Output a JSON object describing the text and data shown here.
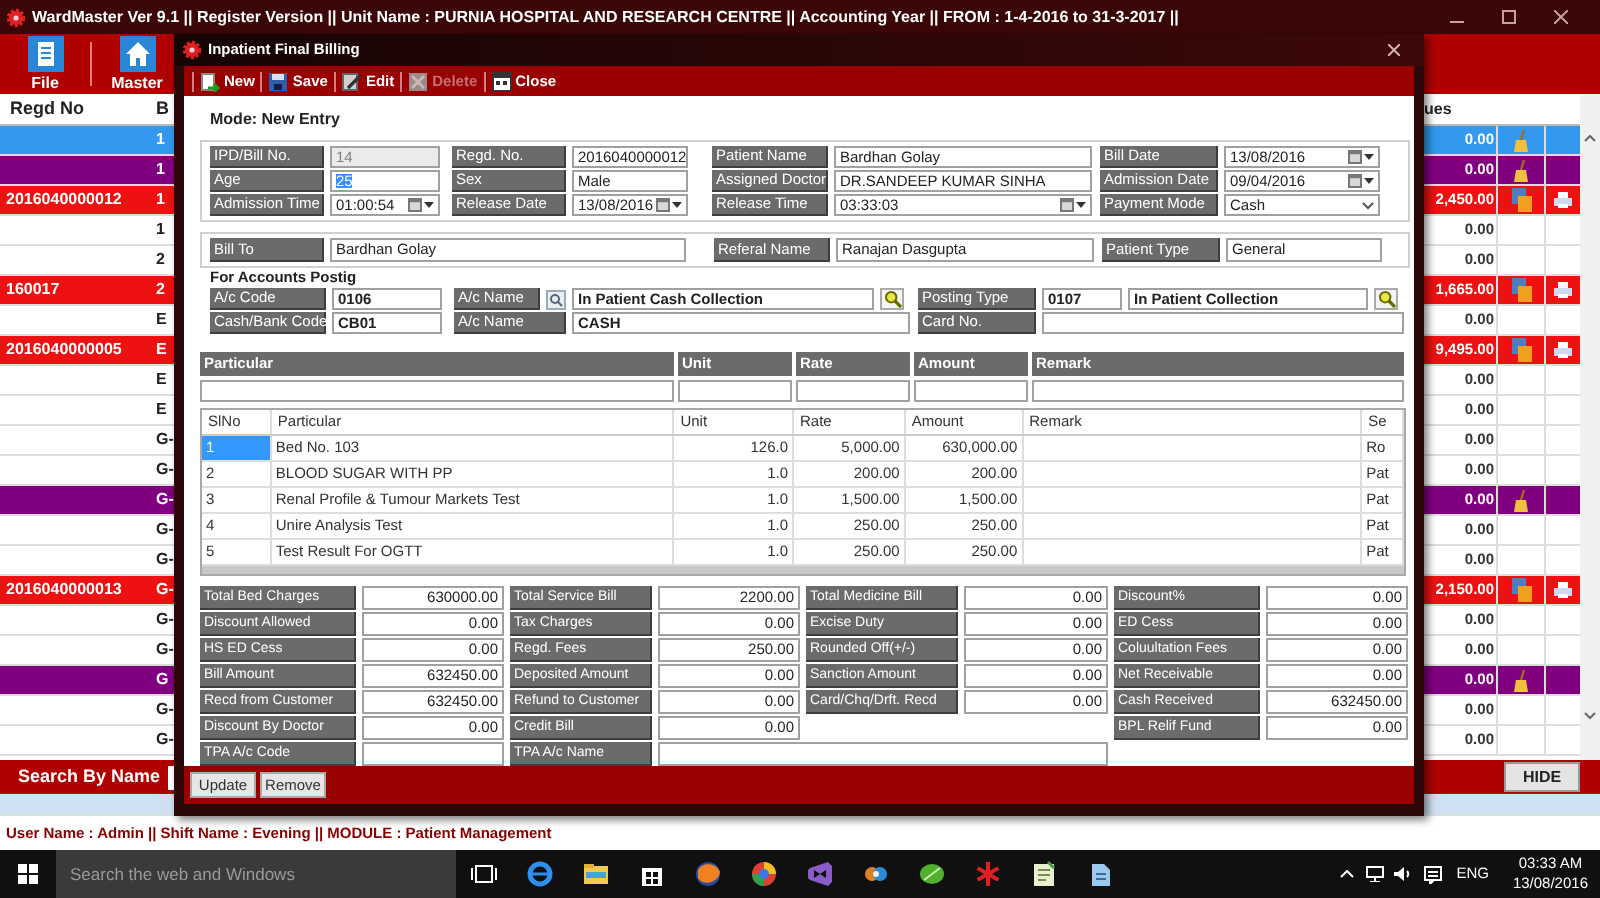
{
  "app_title": "WardMaster Ver 9.1 || Register Version || Unit Name : PURNIA HOSPITAL AND RESEARCH CENTRE || Accounting Year || FROM : 1-4-2016 to 31-3-2017  ||",
  "ribbon": [
    {
      "label": "File",
      "kind": "file"
    },
    {
      "label": "Master",
      "kind": "home"
    }
  ],
  "list": {
    "columns": [
      "Regd No",
      "B",
      "ues"
    ],
    "rows": [
      {
        "column_2": "1",
        "value": "0.00",
        "color": "#3399ee",
        "kind": "cleared"
      },
      {
        "column_2": "1",
        "value": "0.00",
        "color": "#800080",
        "kind": "cleared"
      },
      {
        "regd_no": "2016040000012",
        "column_2": "1",
        "value": "2,450.00",
        "color": "#ee1111",
        "kind": "billed"
      },
      {
        "column_2": "1",
        "value": "0.00",
        "color": "#ffffff",
        "kind": "plain"
      },
      {
        "column_2": "2",
        "value": "0.00",
        "color": "#ffffff",
        "kind": "plain"
      },
      {
        "regd_no": "160017",
        "column_2": "2",
        "value": "1,665.00",
        "color": "#ee1111",
        "kind": "billed"
      },
      {
        "column_2": "E",
        "value": "0.00",
        "color": "#ffffff",
        "kind": "plain"
      },
      {
        "regd_no": "2016040000005",
        "column_2": "E",
        "value": "9,495.00",
        "color": "#ee1111",
        "kind": "billed"
      },
      {
        "column_2": "E",
        "value": "0.00",
        "color": "#ffffff",
        "kind": "plain"
      },
      {
        "column_2": "E",
        "value": "0.00",
        "color": "#ffffff",
        "kind": "plain"
      },
      {
        "column_2": "G-",
        "value": "0.00",
        "color": "#ffffff",
        "kind": "plain"
      },
      {
        "column_2": "G-",
        "value": "0.00",
        "color": "#ffffff",
        "kind": "plain"
      },
      {
        "column_2": "G-",
        "value": "0.00",
        "color": "#800080",
        "kind": "cleared"
      },
      {
        "column_2": "G-",
        "value": "0.00",
        "color": "#ffffff",
        "kind": "plain"
      },
      {
        "column_2": "G-",
        "value": "0.00",
        "color": "#ffffff",
        "kind": "plain"
      },
      {
        "regd_no": "2016040000013",
        "column_2": "G-",
        "value": "2,150.00",
        "color": "#ee1111",
        "kind": "billed"
      },
      {
        "column_2": "G-",
        "value": "0.00",
        "color": "#ffffff",
        "kind": "plain"
      },
      {
        "column_2": "G-",
        "value": "0.00",
        "color": "#ffffff",
        "kind": "plain"
      },
      {
        "column_2": "G",
        "value": "0.00",
        "color": "#800080",
        "kind": "cleared"
      },
      {
        "column_2": "G-",
        "value": "0.00",
        "color": "#ffffff",
        "kind": "plain"
      },
      {
        "column_2": "G-",
        "value": "0.00",
        "color": "#ffffff",
        "kind": "plain"
      }
    ]
  },
  "search_label": "Search By Name",
  "hide_button": "HIDE",
  "status_line": "User Name : Admin || Shift Name : Evening || MODULE : Patient Management",
  "dialog": {
    "title": "Inpatient Final Billing",
    "toolbar": [
      {
        "label": "New",
        "kind": "new",
        "disabled": false
      },
      {
        "label": "Save",
        "kind": "save",
        "disabled": false
      },
      {
        "label": "Edit",
        "kind": "edit",
        "disabled": false
      },
      {
        "label": "Delete",
        "kind": "delete",
        "disabled": true
      },
      {
        "label": "Close",
        "kind": "close",
        "disabled": false
      }
    ],
    "mode": "Mode: New Entry",
    "patient_rows": [
      [
        {
          "label": "IPD/Bill No.",
          "value": "14",
          "kind": "readonly"
        },
        {
          "label": "Regd. No.",
          "value": "2016040000012",
          "kind": "text"
        },
        {
          "label": "Patient Name",
          "value": "Bardhan Golay",
          "kind": "text"
        },
        {
          "label": "Bill Date",
          "value": "13/08/2016",
          "kind": "picker"
        }
      ],
      [
        {
          "label": "Age",
          "value": "25",
          "kind": "highlighted"
        },
        {
          "label": "Sex",
          "value": "Male",
          "kind": "text"
        },
        {
          "label": "Assigned Doctor",
          "value": "DR.SANDEEP KUMAR SINHA",
          "kind": "text"
        },
        {
          "label": "Admission Date",
          "value": "09/04/2016",
          "kind": "picker"
        }
      ],
      [
        {
          "label": "Admission Time",
          "value": "01:00:54",
          "kind": "picker"
        },
        {
          "label": "Release Date",
          "value": "13/08/2016",
          "kind": "picker"
        },
        {
          "label": "Release Time",
          "value": "03:33:03",
          "kind": "picker"
        },
        {
          "label": "Payment Mode",
          "value": "Cash",
          "kind": "select"
        }
      ]
    ],
    "bill_row": [
      {
        "label": "Bill To",
        "value": "Bardhan Golay"
      },
      {
        "label": "Referal Name",
        "value": "Ranajan Dasgupta"
      },
      {
        "label": "Patient Type",
        "value": "General"
      }
    ],
    "accounts_heading": "For Accounts Postig",
    "accounts_rows": [
      [
        {
          "label": "A/c Code",
          "value": "0106"
        },
        {
          "label": "A/c Name",
          "value": "In Patient Cash Collection",
          "label_icon": true,
          "lookup": true
        },
        {
          "label": "Posting Type",
          "value": "0107",
          "value_2": "In Patient Collection",
          "lookup": true
        }
      ],
      [
        {
          "label": "Cash/Bank Code",
          "value": "CB01"
        },
        {
          "label": "A/c Name",
          "value": "CASH"
        },
        {
          "label": "Card No."
        }
      ]
    ],
    "entry_columns": [
      "Particular",
      "Unit",
      "Rate",
      "Amount",
      "Remark"
    ],
    "grid": {
      "columns": [
        "SlNo",
        "Particular",
        "Unit",
        "Rate",
        "Amount",
        "Remark",
        "Se"
      ],
      "rows": [
        {
          "sl_no": "1",
          "particular": "Bed No. 103",
          "unit": "126.0",
          "rate": "5,000.00",
          "amount": "630,000.00",
          "column_7": "Ro",
          "selected": true
        },
        {
          "sl_no": "2",
          "particular": "BLOOD SUGAR WITH PP",
          "unit": "1.0",
          "rate": "200.00",
          "amount": "200.00",
          "column_7": "Pat",
          "selected": false
        },
        {
          "sl_no": "3",
          "particular": "Renal Profile & Tumour Markets Test",
          "unit": "1.0",
          "rate": "1,500.00",
          "amount": "1,500.00",
          "column_7": "Pat",
          "selected": false
        },
        {
          "sl_no": "4",
          "particular": "Unire Analysis Test",
          "unit": "1.0",
          "rate": "250.00",
          "amount": "250.00",
          "column_7": "Pat",
          "selected": false
        },
        {
          "sl_no": "5",
          "particular": "Test Result For OGTT",
          "unit": "1.0",
          "rate": "250.00",
          "amount": "250.00",
          "column_7": "Pat",
          "selected": false
        }
      ]
    },
    "totals": [
      [
        {
          "label": "Total Bed Charges",
          "value": "630000.00"
        },
        {
          "label": "Discount Allowed",
          "value": "0.00"
        },
        {
          "label": "HS ED Cess",
          "value": "0.00"
        },
        {
          "label": "Bill Amount",
          "value": "632450.00"
        },
        {
          "label": "Recd from Customer",
          "value": "632450.00"
        },
        {
          "label": "Discount By Doctor",
          "value": "0.00"
        },
        {
          "label": "TPA A/c Code"
        }
      ],
      [
        {
          "label": "Total Service Bill",
          "value": "2200.00"
        },
        {
          "label": "Tax Charges",
          "value": "0.00"
        },
        {
          "label": "Regd. Fees",
          "value": "250.00"
        },
        {
          "label": "Deposited Amount",
          "value": "0.00"
        },
        {
          "label": "Refund to Customer",
          "value": "0.00"
        },
        {
          "label": "Credit Bill",
          "value": "0.00"
        },
        {
          "label": "TPA A/c Name",
          "kind": "wide"
        }
      ],
      [
        {
          "label": "Total Medicine Bill",
          "value": "0.00"
        },
        {
          "label": "Excise Duty",
          "value": "0.00"
        },
        {
          "label": "Rounded Off(+/-)",
          "value": "0.00"
        },
        {
          "label": "Sanction Amount",
          "value": "0.00"
        },
        {
          "label": "Card/Chq/Drft. Recd",
          "value": "0.00"
        }
      ],
      [
        {
          "label": "Discount%",
          "value": "0.00"
        },
        {
          "label": "ED Cess",
          "value": "0.00"
        },
        {
          "label": "Coluultation Fees",
          "value": "0.00"
        },
        {
          "label": "Net Receivable",
          "value": "0.00"
        },
        {
          "label": "Cash Received",
          "value": "632450.00"
        },
        {
          "label": "BPL Relif Fund",
          "value": "0.00"
        }
      ]
    ],
    "footer_buttons": [
      "Update",
      "Remove"
    ]
  },
  "taskbar": {
    "search_placeholder": "Search the web and Windows",
    "language": "ENG",
    "time": "03:33 AM",
    "date": "13/08/2016"
  }
}
